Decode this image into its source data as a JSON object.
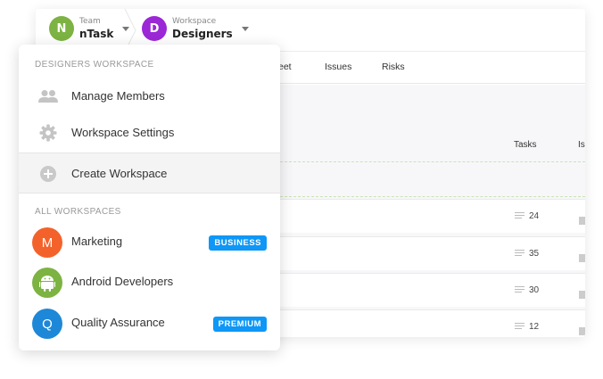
{
  "breadcrumb": {
    "team": {
      "avatar_letter": "N",
      "sub_label": "Team",
      "name": "nTask",
      "color": "#7cb342"
    },
    "workspace": {
      "avatar_letter": "D",
      "sub_label": "Workspace",
      "name": "Designers",
      "color": "#9c27d6"
    }
  },
  "tabs": [
    "eet",
    "Issues",
    "Risks"
  ],
  "columns": {
    "tasks": "Tasks",
    "issues": "Is"
  },
  "rows": [
    {
      "tasks": "24"
    },
    {
      "tasks": "35"
    },
    {
      "tasks": "30"
    },
    {
      "tasks": "12"
    }
  ],
  "dropdown": {
    "current_section": "DESIGNERS WORKSPACE",
    "items": {
      "manage_members": {
        "label": "Manage Members",
        "icon": "people-icon"
      },
      "workspace_settings": {
        "label": "Workspace Settings",
        "icon": "gear-icon"
      },
      "create_workspace": {
        "label": "Create Workspace",
        "icon": "plus-circle-icon"
      }
    },
    "all_section": "ALL WORKSPACES",
    "workspaces": [
      {
        "letter": "M",
        "name": "Marketing",
        "badge": "BUSINESS",
        "color": "#f4622b"
      },
      {
        "letter": "",
        "name": "Android Developers",
        "badge": "",
        "color": "#7cb342",
        "icon": "android-icon"
      },
      {
        "letter": "Q",
        "name": "Quality Assurance",
        "badge": "PREMIUM",
        "color": "#1e88d8"
      }
    ]
  },
  "colors": {
    "badge": "#0e97f7",
    "dashed_line": "#c8e3b5"
  }
}
